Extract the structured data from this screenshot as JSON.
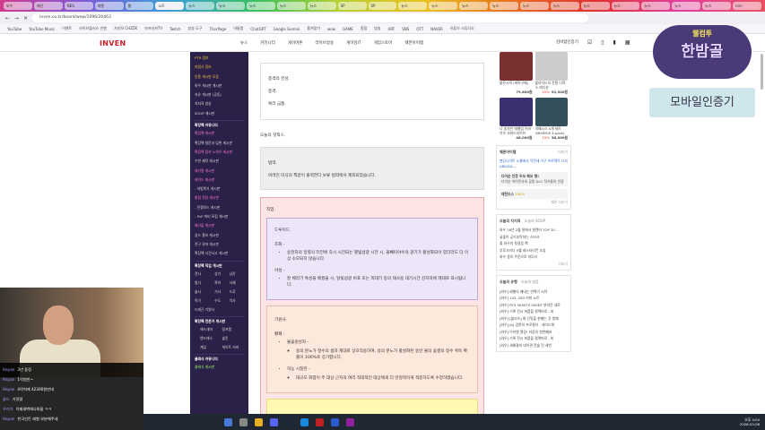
{
  "browser": {
    "tabs": [
      "보수",
      "메인",
      "NES",
      "레벨",
      "웹",
      "노트",
      "뉴스",
      "뉴스",
      "뉴스",
      "뉴스",
      "뉴스",
      "SP",
      "SP",
      "뉴스",
      "뉴스",
      "뉴스",
      "뉴스",
      "뉴스",
      "뉴스",
      "뉴스",
      "뉴스",
      "뉴스",
      "뉴스",
      "뉴스",
      "nnn"
    ],
    "url": "inven.co.kr/board/wow/1096/20463",
    "bookmarks": [
      "YouTube",
      "YouTube Music",
      "이벤트",
      "라이브플러스 인벤",
      "치지직 CHZZK",
      "아프리카TV",
      "Twitch",
      "방송 도구",
      "ThorPage",
      "아톰랩",
      "ChatGPT",
      "Google Gemini",
      "즐겨찾기",
      "wow",
      "GAME",
      "종합",
      "방송",
      "ART",
      "SNS",
      "OTT",
      "NAVER",
      "유튜브 스튜디오"
    ]
  },
  "header": {
    "logo": "INVEN",
    "menu": [
      "뉴스",
      "커뮤니티",
      "게이머존",
      "라이브방송",
      "게이밍IT",
      "게임스토어",
      "웨폰아이템"
    ],
    "user": "김바람인증기"
  },
  "sidebar": {
    "items": [
      {
        "t": "PTR 정보",
        "c": "yel"
      },
      {
        "t": "마법사 정보",
        "c": "yel"
      },
      {
        "t": "인용 게시판 모음",
        "c": "yel"
      },
      {
        "t": "와우 게시판 게시판",
        "c": ""
      },
      {
        "t": "자유 게시판 (공동)",
        "c": ""
      },
      {
        "t": "치지직 방송",
        "c": ""
      },
      {
        "t": "SOOP 게시판",
        "c": ""
      },
      {
        "t": "확장팩 커뮤니티",
        "c": "sec"
      },
      {
        "t": "확장팩 게시판",
        "c": "pink"
      },
      {
        "t": "확장팩 질문과 답변 게시판",
        "c": ""
      },
      {
        "t": "확장팩 접속 노하우 게시판",
        "c": "pink"
      },
      {
        "t": "수번 제작 게시판",
        "c": ""
      },
      {
        "t": "레기원 게시판",
        "c": "pink"
      },
      {
        "t": "레이드 게시판",
        "c": "pink"
      },
      {
        "t": "- 마법폭기 게시판",
        "c": ""
      },
      {
        "t": "통합 전장 게시판",
        "c": "pink"
      },
      {
        "t": "- 전쟁모드 게시판",
        "c": ""
      },
      {
        "t": "- PvP 파티 모집 게시판",
        "c": ""
      },
      {
        "t": "쐐기돌 게시판",
        "c": "pink"
      },
      {
        "t": "길드 홍보 게시판",
        "c": ""
      },
      {
        "t": "전구 유머 게시판",
        "c": ""
      },
      {
        "t": "확장팩 사건사고 게시판",
        "c": ""
      }
    ],
    "class_title": "확장팩 직업 게시판",
    "classes": [
      "전사",
      "성기",
      "냥꾼",
      "법사",
      "흑마",
      "사제",
      "술사",
      "기사",
      "드루",
      "죽기",
      "수도",
      "악사",
      "드래곤 기원사"
    ],
    "mgmt_title": "확장팩 전문가 게시판",
    "mgmt": [
      "애드새마",
      "림프랩",
      "엔드래스",
      "솔린",
      "게임",
      "게이트 서버"
    ],
    "bottom_title": "클래식 커뮤니티",
    "bottom_item": "클래식 게시판"
  },
  "article": {
    "box1": [
      "충격의 전성.",
      "충격.",
      "복리 금품."
    ],
    "hotfix_title": "오늘의 핫픽스.",
    "gray_title": "법력.",
    "gray_text": "버려진 미식의 책끝이 출력한다 보류 법력에서 제외되었습니다.",
    "class_title": "직업.",
    "druid": {
      "title": "드루이드.",
      "spec1": "조화 -",
      "spec1_bullet": "승천자의 일렬식 터전에 즉시 시전되는 별빛섬광 시전 시, 올빼미야수의 광기가 활성화되어 있더라도 더 이상 소모되지 않습니다.",
      "spec2": "야성 -",
      "spec2_bullet": "잘 베라기 특성을 배웠을 시, 달빛섬광 버프 또는 먹대기 등의 재사용 대기시간 감지자에 제대로 표시됩니다."
    },
    "evoker": {
      "title": "기원사.",
      "spec": "황폐 -",
      "talent1": "불꽃원성자 -",
      "talent1_text": "용의 분노가 정수의 샘과 제대로 상호작용하여, 용의 분노가 활성화된 동안 불의 숨결의 정수 획득 확률이 100%로 증가합니다.",
      "talent2": "허능 시찰관 -",
      "talent2_text": "대규모 화염이 주 대상 근처의 여러 적대적인 대상에게 더 안정적이게 적중하도록 수정하였습니다."
    }
  },
  "right": {
    "products": [
      {
        "name": "붉은시력 (에픽구매)",
        "price": "79,800원"
      },
      {
        "name": "블리자드의 전쟁 디럭스 에디션",
        "price": "92,540원",
        "discount": "10%"
      },
      {
        "name": "나 혼자만 레벨업 어라이즈 오버드라이브",
        "price": "46,000원"
      },
      {
        "name": "미메시스 4개 세트 (MIMESIS 4-pack)",
        "price": "36,000원",
        "discount": "10%"
      }
    ],
    "weapon_title": "웨폰아이템",
    "weapon_more": "더보기",
    "weapon_item": "펜딩나이트 노벨에서 작전세 이구 프로젝트 디자 ABIGAIL...",
    "review1": "다이순 인장 두쏘 패쏘 형!",
    "review1_sub": "다이순 아이콘사의 공동 DLC 작가들의 인정",
    "review2": "레전드스",
    "review2_sub": "100%",
    "weapon_footer": "웨폰 더보기",
    "tabs": [
      "오늘의 치지직",
      "오늘의 SOOP"
    ],
    "streams": [
      "와우 26년 2월 말에서 발렌타 TOP 30 -",
      "글출이 공기부탁하는 스타크",
      "좋 와우의 첫걸음 팩",
      "부후끄러다 5월 레스터리컨 조심",
      "와우 용의 주문으로 마무리"
    ],
    "streams_more": "더보기",
    "tabs2": [
      "오늘의 유행",
      "오늘의 영웅"
    ],
    "trends": [
      "[와우] 레벨의 때내는 반짝기 시작",
      "[와우] 103, 263 커피 노트",
      "[와우] RTX 5090TX 500DT 뿌려진 새로",
      "[와우] 기록 전시 퍼품을 컬렉따로 - 비",
      "[와우] [블리즈] 최 단맛을 판매는 것 명쾌",
      "[와우] J&J 검쪽의 프로필이 - 레이드해",
      "[와우] 이미엔 멀랑! 처음의 첫번째바",
      "[와우] 기록 전시 퍼품을 컬렉따로 - 비",
      "[와우] 새해결의 데이관 전술 전 세번"
    ]
  },
  "overlay": {
    "logo_small": "웰컴투",
    "logo_big": "한밤골",
    "mobile": "모바일인증기"
  },
  "chat": [
    {
      "user": "Hayan",
      "msg": "3년 동정"
    },
    {
      "user": "Hayan",
      "msg": "1억원만~"
    },
    {
      "user": "Hayan",
      "msg": "4억씩에 42300원만대"
    },
    {
      "user": "솔드",
      "msg": "거짓말"
    },
    {
      "user": "우리가",
      "msg": "이제새벽에나와을 ㅋㅋ"
    },
    {
      "user": "Hayan",
      "msg": "한국인돈 레벌 보분해주세"
    }
  ],
  "taskbar": {
    "time": "오후 4:04",
    "date": "2026-03-06"
  }
}
